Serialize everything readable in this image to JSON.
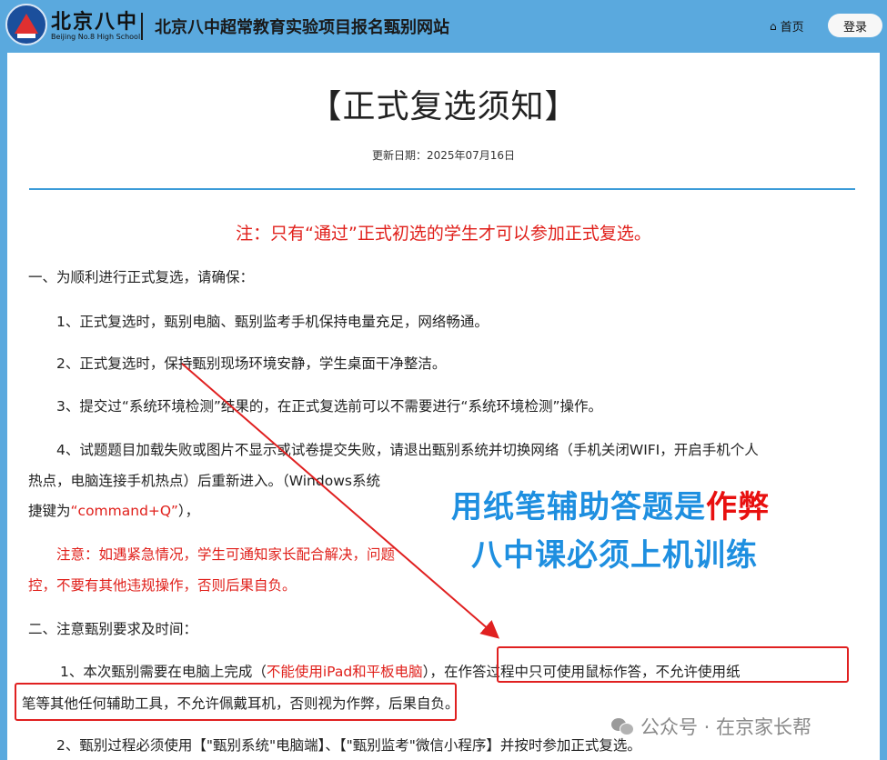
{
  "header": {
    "logo_cn": "北京八中",
    "logo_en": "Beijing No.8 High School",
    "site_title": "北京八中超常教育实验项目报名甄别网站",
    "nav_home": "首页",
    "login": "登录"
  },
  "article": {
    "title": "【正式复选须知】",
    "update_date": "更新日期：2025年07月16日",
    "notice": "注：只有“通过”正式初选的学生才可以参加正式复选。",
    "s1_heading": "一、为顺利进行正式复选，请确保：",
    "s1_item1": "1、正式复选时，甄别电脑、甄别监考手机保持电量充足，网络畅通。",
    "s1_item2": "2、正式复选时，保持甄别现场环境安静，学生桌面干净整洁。",
    "s1_item3": "3、提交过“系统环境检测”结果的，在正式复选前可以不需要进行“系统环境检测”操作。",
    "s1_item4_line1": "4、试题题目加载失败或图片不显示或试卷提交失败，请退出甄别系统并切换网络（手机关闭WIFI，开启手机个人",
    "s1_item4_line2": "热点，电脑连接手机热点）后重新进入。（Windows系统",
    "s1_item4_line3_a": "捷键为",
    "s1_item4_line3_b": "“command+Q”",
    "s1_item4_line3_c": "），",
    "s1_warning_line1": "注意：如遇紧急情况，学生可通知家长配合解决，问题",
    "s1_warning_line2": "控，不要有其他违规操作，否则后果自负。",
    "s2_heading": "二、注意甄别要求及时间：",
    "s2_item1_a": "1、本次甄别需要在电脑上完成（",
    "s2_item1_b": "不能使用iPad和平板电脑",
    "s2_item1_c": "），",
    "s2_item1_d": "在作答过程中只可使用鼠标作答，不允许使用纸",
    "s2_item1_line2_a": "笔等其他任何辅助工具，不允许佩戴耳机，否则视为作弊，",
    "s2_item1_line2_b": "后果自负。",
    "s2_item2": "2、甄别过程必须使用【\"甄别系统\"电脑端】、【\"甄别监考\"微信小程序】并按时参加正式复选。"
  },
  "overlay": {
    "line1_a": "用纸笔辅助答题是",
    "line1_b": "作弊",
    "line2": "八中课必须上机训练"
  },
  "watermark": {
    "text": "公众号 · 在京家长帮"
  },
  "colors": {
    "header_bg": "#5aa9de",
    "notice_red": "#e0201b",
    "overlay_blue": "#1e8fe0",
    "overlay_red": "#e8100f",
    "rule_blue": "#3b9bd8"
  }
}
